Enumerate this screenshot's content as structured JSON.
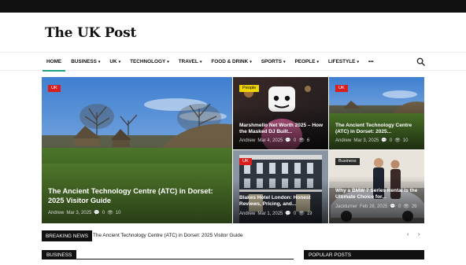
{
  "site": {
    "name": "The UK Post"
  },
  "nav": {
    "items": [
      {
        "label": "HOME",
        "caret": ""
      },
      {
        "label": "BUSINESS",
        "caret": "▾"
      },
      {
        "label": "UK",
        "caret": "▾"
      },
      {
        "label": "TECHNOLOGY",
        "caret": "▾"
      },
      {
        "label": "TRAVEL",
        "caret": "▾"
      },
      {
        "label": "FOOD & DRINK",
        "caret": "▾"
      },
      {
        "label": "SPORTS",
        "caret": "▾"
      },
      {
        "label": "PEOPLE",
        "caret": "▾"
      },
      {
        "label": "LIFESTYLE",
        "caret": "▾"
      },
      {
        "label": "•••",
        "caret": ""
      }
    ],
    "search_icon": "search-icon"
  },
  "featured": {
    "main": {
      "badge": "UK",
      "title": "The Ancient Technology Centre (ATC) in Dorset: 2025 Visitor Guide",
      "author": "Andrew",
      "date": "Mar 3, 2025",
      "comments": "0",
      "views": "10"
    },
    "tiles": [
      {
        "badge": "People",
        "badge_color": "#f0d400",
        "title": "Marshmello Net Worth 2025 – How the Masked DJ Built...",
        "author": "Andrew",
        "date": "Mar 4, 2025",
        "comments": "0",
        "views": "6"
      },
      {
        "badge": "UK",
        "badge_color": "#d81e1e",
        "title": "The Ancient Technology Centre (ATC) in Dorset: 2025...",
        "author": "Andrew",
        "date": "Mar 3, 2025",
        "comments": "0",
        "views": "10"
      },
      {
        "badge": "UK",
        "badge_color": "#d81e1e",
        "title": "Blakes Hotel London: Honest Reviews, Pricing, and...",
        "author": "Andrew",
        "date": "Mar 1, 2025",
        "comments": "0",
        "views": "19"
      },
      {
        "badge": "Business",
        "badge_color": "#2a2a2a",
        "title": "Why a BMW 7 Series Rental Is the Ultimate Choice for...",
        "author": "Jackturner",
        "date": "Feb 28, 2025",
        "comments": "0",
        "views": "26"
      }
    ]
  },
  "breaking": {
    "label": "BREAKING NEWS",
    "text": "The Ancient Technology Centre (ATC) in Dorset: 2025 Visitor Guide",
    "prev": "‹",
    "next": "›"
  },
  "sections": {
    "business": "BUSINESS",
    "popular": "POPULAR POSTS"
  },
  "colors": {
    "accent": "#1aa287",
    "badge_red": "#d81e1e",
    "badge_yellow": "#f0d400"
  }
}
